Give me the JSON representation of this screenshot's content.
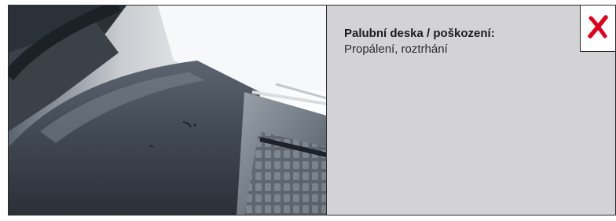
{
  "damage_card": {
    "title": "Palubní deska / poškození:",
    "value": "Propálení, roztrhání",
    "status_icon": "red-x-icon",
    "status_color": "#e3001b",
    "photo_subject": "dashboard-photo"
  }
}
